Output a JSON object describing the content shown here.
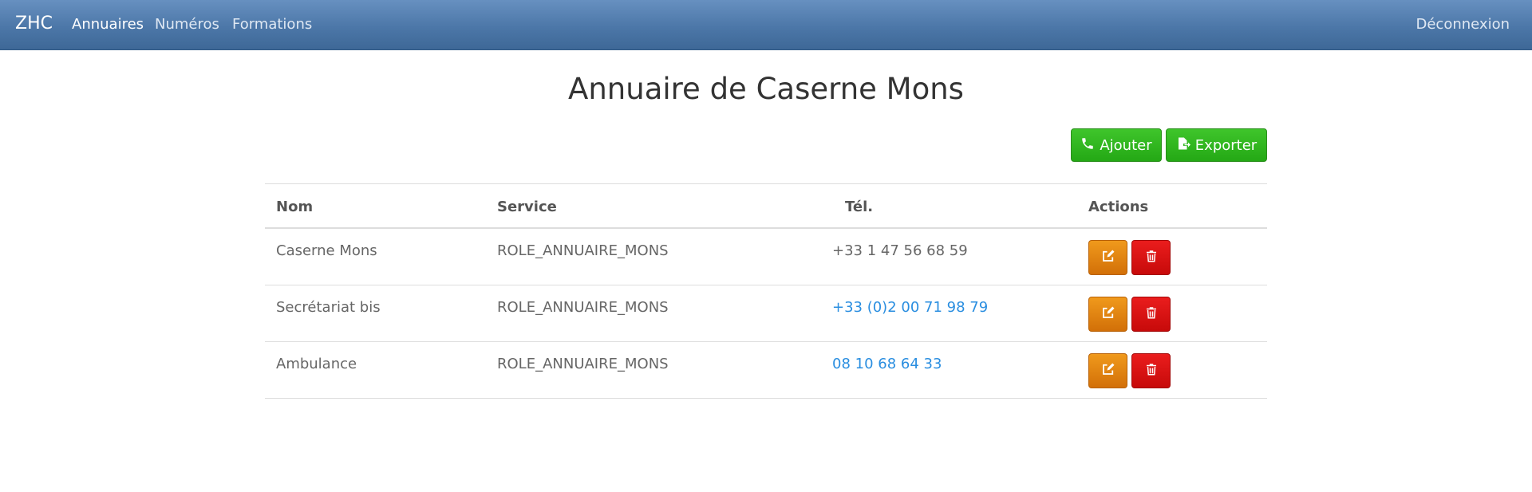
{
  "navbar": {
    "brand": "ZHC",
    "items": [
      {
        "label": "Annuaires",
        "active": true
      },
      {
        "label": "Numéros",
        "active": false
      },
      {
        "label": "Formations",
        "active": false
      }
    ],
    "logout": "Déconnexion"
  },
  "page": {
    "title": "Annuaire de Caserne Mons"
  },
  "toolbar": {
    "add_label": "Ajouter",
    "add_icon": "phone-icon",
    "export_label": "Exporter",
    "export_icon": "file-export-icon",
    "color": "#2fb41f"
  },
  "table": {
    "headers": [
      "Nom",
      "Service",
      "Tél.",
      "Actions"
    ],
    "rows": [
      {
        "nom": "Caserne Mons",
        "service": "ROLE_ANNUAIRE_MONS",
        "tel": "+33 1 47 56 68 59",
        "tel_link": false
      },
      {
        "nom": "Secrétariat bis",
        "service": "ROLE_ANNUAIRE_MONS",
        "tel": "+33 (0)2 00 71 98 79",
        "tel_link": true
      },
      {
        "nom": "Ambulance",
        "service": "ROLE_ANNUAIRE_MONS",
        "tel": "08 10 68 64 33",
        "tel_link": true
      }
    ],
    "action_colors": {
      "edit": "#e4830f",
      "delete": "#dd1414"
    },
    "link_color": "#2a8ee0"
  }
}
